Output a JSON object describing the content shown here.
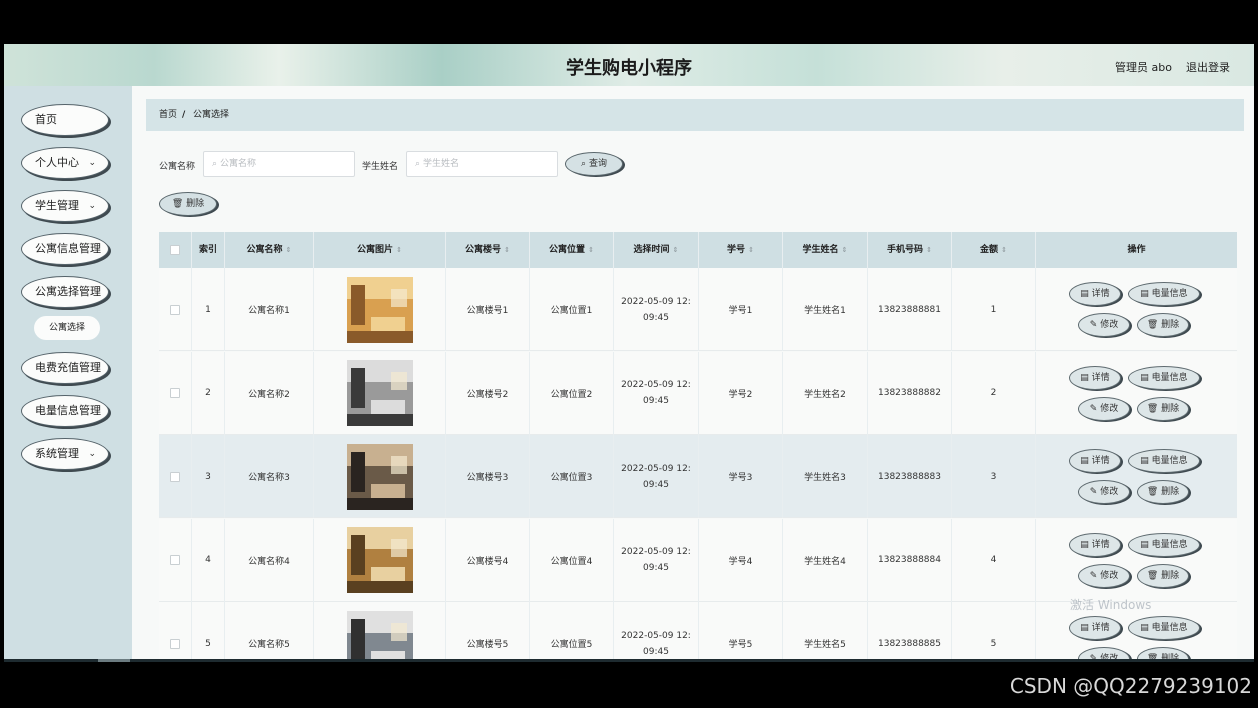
{
  "header": {
    "title": "学生购电小程序",
    "admin": "管理员 abo",
    "logout": "退出登录"
  },
  "sidebar": {
    "items": [
      {
        "label": "首页",
        "chevron": false
      },
      {
        "label": "个人中心",
        "chevron": true
      },
      {
        "label": "学生管理",
        "chevron": true
      },
      {
        "label": "公寓信息管理",
        "chevron": false
      },
      {
        "label": "公寓选择管理",
        "chevron": false
      },
      {
        "label": "电费充值管理",
        "chevron": false
      },
      {
        "label": "电量信息管理",
        "chevron": false
      },
      {
        "label": "系统管理",
        "chevron": true
      }
    ],
    "sub_item": "公寓选择"
  },
  "breadcrumb": {
    "home": "首页",
    "separator": "/",
    "current": "公寓选择"
  },
  "filters": {
    "apartment_label": "公寓名称",
    "apartment_placeholder": "公寓名称",
    "student_label": "学生姓名",
    "student_placeholder": "学生姓名",
    "query_button": "查询",
    "delete_button": "删除"
  },
  "table": {
    "columns": [
      "索引",
      "公寓名称",
      "公寓图片",
      "公寓楼号",
      "公寓位置",
      "选择时间",
      "学号",
      "学生姓名",
      "手机号码",
      "金额",
      "操作"
    ],
    "rows": [
      {
        "index": "1",
        "name": "公寓名称1",
        "building": "公寓楼号1",
        "location": "公寓位置1",
        "time1": "2022-05-09 12:",
        "time2": "09:45",
        "sid": "学号1",
        "student": "学生姓名1",
        "phone": "13823888881",
        "amount": "1"
      },
      {
        "index": "2",
        "name": "公寓名称2",
        "building": "公寓楼号2",
        "location": "公寓位置2",
        "time1": "2022-05-09 12:",
        "time2": "09:45",
        "sid": "学号2",
        "student": "学生姓名2",
        "phone": "13823888882",
        "amount": "2"
      },
      {
        "index": "3",
        "name": "公寓名称3",
        "building": "公寓楼号3",
        "location": "公寓位置3",
        "time1": "2022-05-09 12:",
        "time2": "09:45",
        "sid": "学号3",
        "student": "学生姓名3",
        "phone": "13823888883",
        "amount": "3"
      },
      {
        "index": "4",
        "name": "公寓名称4",
        "building": "公寓楼号4",
        "location": "公寓位置4",
        "time1": "2022-05-09 12:",
        "time2": "09:45",
        "sid": "学号4",
        "student": "学生姓名4",
        "phone": "13823888884",
        "amount": "4"
      },
      {
        "index": "5",
        "name": "公寓名称5",
        "building": "公寓楼号5",
        "location": "公寓位置5",
        "time1": "2022-05-09 12:",
        "time2": "09:45",
        "sid": "学号5",
        "student": "学生姓名5",
        "phone": "13823888885",
        "amount": "5"
      }
    ],
    "actions": {
      "detail": "详情",
      "power": "电量信息",
      "edit": "修改",
      "delete": "删除"
    }
  },
  "overlay": {
    "windows_activate": "激活 Windows",
    "csdn": "CSDN @QQ2279239102"
  },
  "colors": {
    "sidebar_bg": "#cfdfe3",
    "header_bg": "#cfe3d9",
    "table_header_bg": "#cfdfe3",
    "button_bg": "#d5e1e4"
  }
}
